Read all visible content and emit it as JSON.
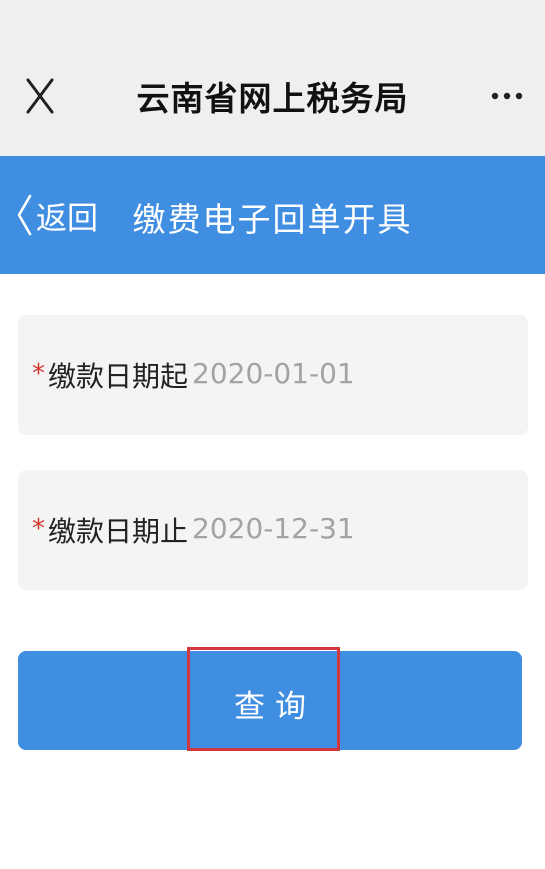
{
  "app_header": {
    "title": "云南省网上税务局",
    "close_icon": "close-icon",
    "more_icon": "more-horizontal-icon"
  },
  "nav": {
    "back_label": "返回",
    "back_icon": "chevron-left-icon",
    "title": "缴费电子回单开具"
  },
  "form": {
    "start_date": {
      "required_mark": "*",
      "label": "缴款日期起",
      "value": "2020-01-01"
    },
    "end_date": {
      "required_mark": "*",
      "label": "缴款日期止",
      "value": "2020-12-31"
    },
    "query_label": "查询"
  },
  "colors": {
    "primary": "#3f8ee2",
    "header_bg": "#efefef",
    "field_bg": "#f4f4f4",
    "required": "#d9342b",
    "highlight": "#d2373f",
    "placeholder_text": "#a3a3a3"
  }
}
